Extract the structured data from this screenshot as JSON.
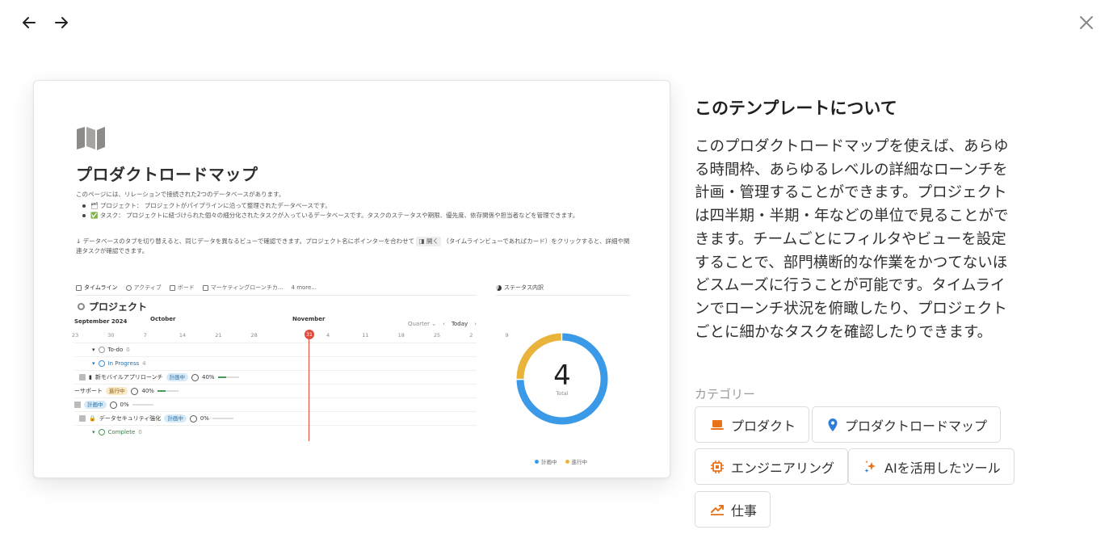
{
  "nav": {
    "back_label": "back",
    "forward_label": "forward",
    "close_label": "close"
  },
  "preview": {
    "title": "プロダクトロードマップ",
    "intro": "このページには、リレーションで接続された2つのデータベースがあります。",
    "bullets": [
      "🗂 プロジェクト： プロジェクトがパイプラインに沿って整理されたデータベースです。",
      "✅ タスク： プロジェクトに紐づけられた個々の細分化されたタスクが入っているデータベースです。タスクのステータスや期限、優先度、依存関係や担当者などを管理できます。"
    ],
    "note_pre": "↓ データベースのタブを切り替えると、同じデータを異なるビューで確認できます。プロジェクト名にポインターを合わせて",
    "note_key": "◨ 開く",
    "note_post": "（タイムラインビューであればカード）をクリックすると、詳細や関連タスクが確認できます。",
    "tabs": [
      "タイムライン",
      "アクティブ",
      "ボード",
      "マーケティングローンチカ...",
      "4 more..."
    ],
    "status_tab": "ステータス内訳",
    "project_heading": "プロジェクト",
    "timeline": {
      "months": [
        "September 2024",
        "October",
        "November"
      ],
      "days": [
        "23",
        "30",
        "7",
        "14",
        "21",
        "28",
        "31",
        "4",
        "11",
        "18",
        "25",
        "2",
        "9"
      ],
      "today_day": "31",
      "quarter_label": "Quarter ⌄",
      "today_label": "Today",
      "groups": {
        "todo": {
          "label": "To-do",
          "count": "0"
        },
        "in_progress": {
          "label": "In Progress",
          "count": "4"
        },
        "complete": {
          "label": "Complete",
          "count": "0"
        }
      },
      "items": [
        {
          "name": "新モバイルアプリローンチ",
          "status": "計画中",
          "percent": "40%",
          "progress": 0.4
        },
        {
          "name": "ーサポート",
          "status": "進行中",
          "percent": "40%",
          "progress": 0.4
        },
        {
          "name": "",
          "status": "計画中",
          "percent": "0%",
          "progress": 0
        },
        {
          "name": "データセキュリティ強化",
          "status": "計画中",
          "percent": "0%",
          "progress": 0
        }
      ]
    },
    "donut": {
      "total": "4",
      "total_label": "Total",
      "slices": [
        {
          "label": "計画中",
          "value": 3,
          "color": "#3b9ae8"
        },
        {
          "label": "進行中",
          "value": 1,
          "color": "#e8b43c"
        }
      ]
    }
  },
  "about": {
    "title": "このテンプレートについて",
    "description": "このプロダクトロードマップを使えば、あらゆる時間枠、あらゆるレベルの詳細なローンチを計画・管理することができます。プロジェクトは四半期・半期・年などの単位で見ることができます。チームごとにフィルタやビューを設定することで、部門横断的な作業をかつてないほどスムーズに行うことが可能です。タイムラインでローンチ状況を俯瞰したり、プロジェクトごとに細かなタスクを確認したりできます。",
    "category_label": "カテゴリー",
    "categories": [
      {
        "label": "プロダクト",
        "icon": "laptop-icon"
      },
      {
        "label": "プロダクトロードマップ",
        "icon": "map-pin-icon"
      },
      {
        "label": "エンジニアリング",
        "icon": "chip-icon"
      },
      {
        "label": "AIを活用したツール",
        "icon": "sparkles-icon"
      },
      {
        "label": "仕事",
        "icon": "chart-up-icon"
      }
    ],
    "accent_orange": "#e8731a",
    "accent_blue": "#2f7fd6"
  }
}
